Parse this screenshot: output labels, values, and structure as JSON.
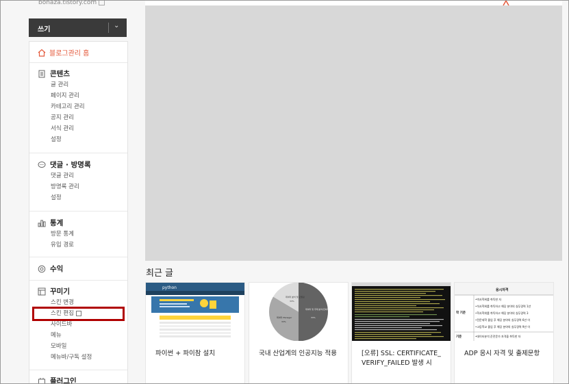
{
  "sidebar": {
    "blog_url": "bonaza.tistory.com",
    "write_label": "쓰기",
    "home_label": "블로그관리 홈",
    "sections": [
      {
        "title": "콘텐츠",
        "items": [
          "글 관리",
          "페이지 관리",
          "카테고리 관리",
          "공지 관리",
          "서식 관리",
          "설정"
        ]
      },
      {
        "title": "댓글 · 방명록",
        "items": [
          "댓글 관리",
          "방명록 관리",
          "설정"
        ]
      },
      {
        "title": "통계",
        "items": [
          "방문 통계",
          "유입 경로"
        ]
      },
      {
        "title": "수익",
        "items": []
      },
      {
        "title": "꾸미기",
        "items": [
          "스킨 변경",
          "스킨 편집",
          "사이드바",
          "메뉴",
          "모바일",
          "메뉴바/구독 설정"
        ]
      },
      {
        "title": "플러그인",
        "items": []
      }
    ]
  },
  "main": {
    "recent_title": "최근 글",
    "posts": [
      {
        "title": "파이썬 + 파이참 설치",
        "thumb_logo": "python"
      },
      {
        "title": "국내 산업계의 인공지능 적용",
        "thumb_labels": [
          "데이터 분석 및 모델링",
          "데이터 Manager",
          "데이터 및 주제 분석/전처리"
        ],
        "thumb_values": [
          "33%",
          "33%",
          "33%"
        ]
      },
      {
        "title": "[오류] SSL: CERTIFICATE_VERIFY_FAILED 발생 시"
      },
      {
        "title": "ADP 응시 자격 및 출제문항",
        "thumb_header": "응시자격",
        "thumb_label1": "학 기준",
        "thumb_label2": "기준",
        "thumb_rows": [
          "•박사학위를 취득한 자",
          "•석사학위를 취득하고 해당 분야의 실무경력 1년",
          "•학사학위를 취득하고 해당 분야의 실무경력 3",
          "•전문대학 졸업 후 해당 분야의 실무경력 6년 이",
          "•고등학교 졸업 후 해당 분야의 실무경력 9년 이",
          "•데이터분석 준전문가 자격을 취득한 자"
        ]
      }
    ]
  },
  "colors": {
    "accent": "#e4593b",
    "highlight_border": "#b00000",
    "write_bar": "#3a3a3a",
    "hero_placeholder": "#d8d8d8"
  }
}
